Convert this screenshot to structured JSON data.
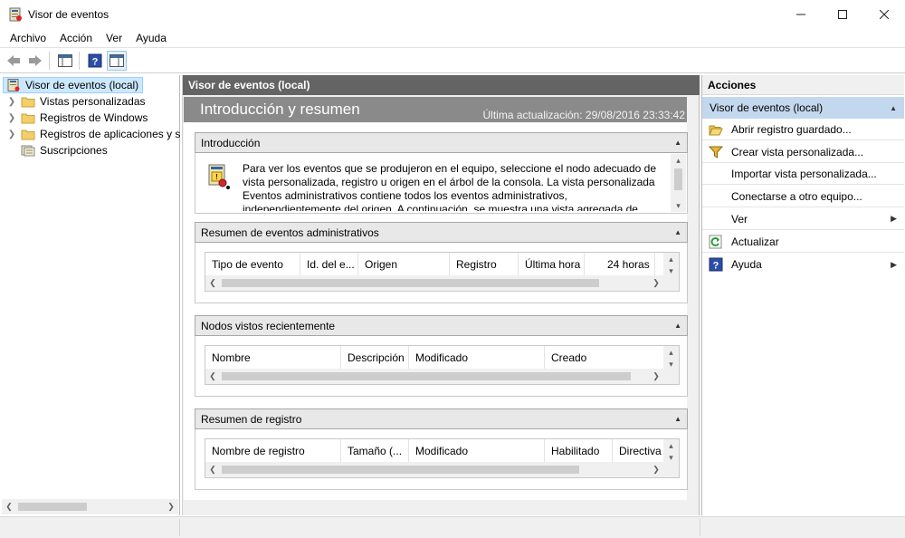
{
  "window": {
    "title": "Visor de eventos"
  },
  "menu": [
    "Archivo",
    "Acción",
    "Ver",
    "Ayuda"
  ],
  "tree": {
    "root": "Visor de eventos (local)",
    "items": [
      {
        "label": "Vistas personalizadas",
        "icon": "folder-icon"
      },
      {
        "label": "Registros de Windows",
        "icon": "folder-icon"
      },
      {
        "label": "Registros de aplicaciones y s",
        "icon": "folder-icon"
      },
      {
        "label": "Suscripciones",
        "icon": "subscriptions-icon"
      }
    ]
  },
  "center": {
    "header": "Visor de eventos (local)",
    "banner_title": "Introducción y resumen",
    "last_updated": "Última actualización: 29/08/2016 23:33:42",
    "intro": {
      "title": "Introducción",
      "text": "Para ver los eventos que se produjeron en el equipo, seleccione el nodo adecuado de vista personalizada, registro u origen en el árbol de la consola. La vista personalizada Eventos administrativos contiene todos los eventos administrativos, independientemente del origen. A continuación, se muestra una vista agregada de"
    },
    "admin_summary": {
      "title": "Resumen de eventos administrativos",
      "columns": [
        "Tipo de evento",
        "Id. del e...",
        "Origen",
        "Registro",
        "Última hora",
        "24 horas"
      ]
    },
    "recent_nodes": {
      "title": "Nodos vistos recientemente",
      "columns": [
        "Nombre",
        "Descripción",
        "Modificado",
        "Creado"
      ]
    },
    "log_summary": {
      "title": "Resumen de registro",
      "columns": [
        "Nombre de registro",
        "Tamaño (...",
        "Modificado",
        "Habilitado",
        "Directiva"
      ]
    }
  },
  "actions": {
    "title": "Acciones",
    "group": "Visor de eventos (local)",
    "items": [
      {
        "label": "Abrir registro guardado...",
        "icon": "open-folder-icon"
      },
      {
        "label": "Crear vista personalizada...",
        "icon": "filter-icon"
      },
      {
        "label": "Importar vista personalizada...",
        "icon": ""
      },
      {
        "label": "Conectarse a otro equipo...",
        "icon": ""
      },
      {
        "label": "Ver",
        "icon": ""
      },
      {
        "label": "Actualizar",
        "icon": "refresh-icon"
      },
      {
        "label": "Ayuda",
        "icon": "help-icon"
      }
    ]
  },
  "colors": {
    "accent_selected": "#cce8ff",
    "center_header": "#646464",
    "banner": "#8a8a8a",
    "actions_group": "#c3d8ee"
  }
}
